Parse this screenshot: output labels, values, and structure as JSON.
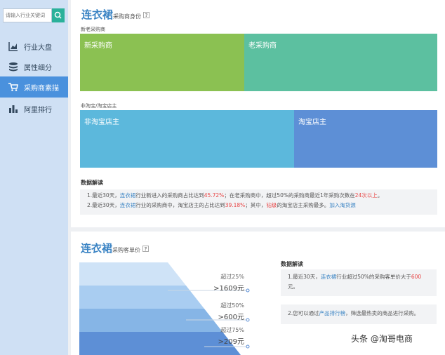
{
  "sidebar": {
    "search_placeholder": "请输入行业关键词",
    "items": [
      {
        "label": "行业大盘"
      },
      {
        "label": "属性细分"
      },
      {
        "label": "采购商素描"
      },
      {
        "label": "阿里排行"
      }
    ]
  },
  "identity_panel": {
    "title": "连衣裙",
    "subtitle": "采购商身份",
    "help": "?",
    "section1_label": "新老采购商",
    "block_new": "新采购商",
    "block_old": "老采购商",
    "section2_label": "非淘宝/淘宝店主",
    "block_nontaobao": "非淘宝店主",
    "block_taobao": "淘宝店主",
    "analysis_title": "数据解读",
    "line1": {
      "a": "1.最近30天，",
      "b": "连衣裙",
      "c": "行业新进入的采购商占比达到",
      "d": "45.72%",
      "e": "；在老采购商中，超过50%的采购商最近1年采购次数在",
      "f": "24次以上",
      "g": "。"
    },
    "line2": {
      "a": "2.最近30天，",
      "b": "连衣裙",
      "c": "行业的采购商中，淘宝店主的占比达到",
      "d": "39.18%",
      "e": "；其中，",
      "f": "钻级",
      "g": "的淘宝店主采购最多。",
      "h": "加入淘货源"
    }
  },
  "price_panel": {
    "title": "连衣裙",
    "subtitle": "采购客单价",
    "help": "?",
    "funnel": [
      {
        "label": "超过25%",
        "value": ">1609元"
      },
      {
        "label": "超过50%",
        "value": ">600元"
      },
      {
        "label": "超过75%",
        "value": ">209元"
      }
    ],
    "analysis_title": "数据解读",
    "box1": {
      "a": "1.最近30天，",
      "b": "连衣裙",
      "c": "行业超过50%的采购客单价大于",
      "d": "600",
      "e": "元。"
    },
    "box2": {
      "a": "2.您可以通过",
      "b": "产品排行榜",
      "c": "，筛选最热卖的商品进行采购。"
    }
  },
  "watermark": "头条 @淘哥电商",
  "colors": {
    "new": "#8bc152",
    "old": "#5cc0a0",
    "nontaobao": "#5cb8dc",
    "taobao": "#5d8fd6",
    "sidebar_active": "#4a91dd",
    "search_btn": "#2bb19a"
  }
}
